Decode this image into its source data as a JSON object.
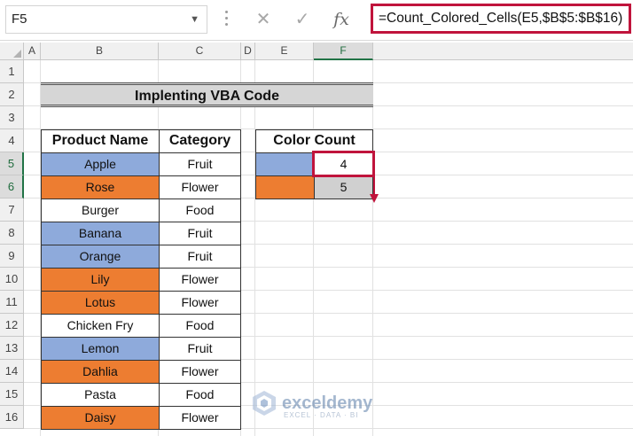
{
  "formula_bar": {
    "name_box": "F5",
    "cancel_icon": "✕",
    "enter_icon": "✓",
    "fx_label": "fx",
    "formula": "=Count_Colored_Cells(E5,$B$5:$B$16)"
  },
  "columns": [
    "A",
    "B",
    "C",
    "D",
    "E",
    "F"
  ],
  "rows": [
    "1",
    "2",
    "3",
    "4",
    "5",
    "6",
    "7",
    "8",
    "9",
    "10",
    "11",
    "12",
    "13",
    "14",
    "15",
    "16"
  ],
  "title": "Implenting VBA Code",
  "product_table": {
    "headers": [
      "Product Name",
      "Category"
    ],
    "rows": [
      {
        "name": "Apple",
        "category": "Fruit",
        "color": "#8eaadb"
      },
      {
        "name": "Rose",
        "category": "Flower",
        "color": "#ed7d31"
      },
      {
        "name": "Burger",
        "category": "Food",
        "color": "#ffffff"
      },
      {
        "name": "Banana",
        "category": "Fruit",
        "color": "#8eaadb"
      },
      {
        "name": "Orange",
        "category": "Fruit",
        "color": "#8eaadb"
      },
      {
        "name": "Lily",
        "category": "Flower",
        "color": "#ed7d31"
      },
      {
        "name": "Lotus",
        "category": "Flower",
        "color": "#ed7d31"
      },
      {
        "name": "Chicken Fry",
        "category": "Food",
        "color": "#ffffff"
      },
      {
        "name": "Lemon",
        "category": "Fruit",
        "color": "#8eaadb"
      },
      {
        "name": "Dahlia",
        "category": "Flower",
        "color": "#ed7d31"
      },
      {
        "name": "Pasta",
        "category": "Food",
        "color": "#ffffff"
      },
      {
        "name": "Daisy",
        "category": "Flower",
        "color": "#ed7d31"
      }
    ]
  },
  "color_count": {
    "header": "Color Count",
    "rows": [
      {
        "color": "#8eaadb",
        "count": "4"
      },
      {
        "color": "#ed7d31",
        "count": "5"
      }
    ]
  },
  "watermark": {
    "name": "exceldemy",
    "tagline": "EXCEL · DATA · BI"
  },
  "accent_color": "#c0143c"
}
